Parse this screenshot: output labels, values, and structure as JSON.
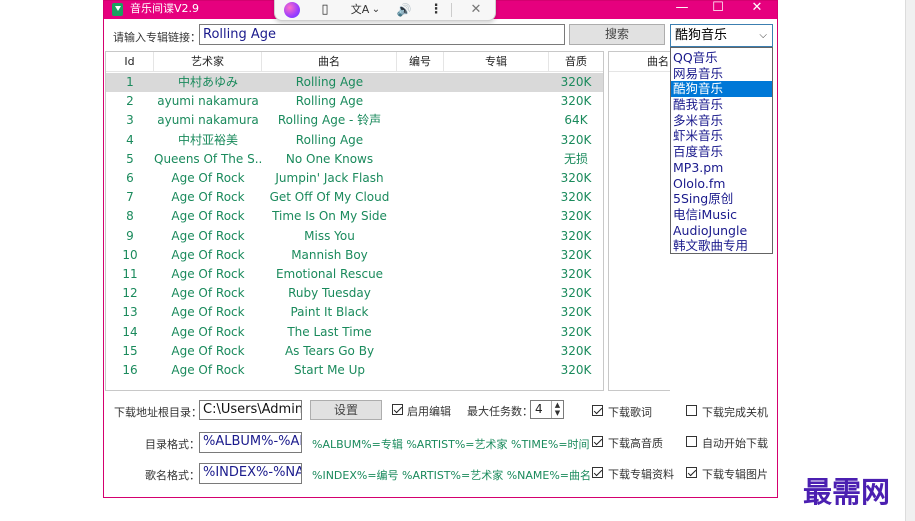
{
  "window": {
    "title": "音乐间谍V2.9",
    "controls": {
      "minimize": "—",
      "maximize": "☐",
      "close": "✕"
    }
  },
  "overlay_toolbar": {
    "icons": [
      "brain-icon",
      "tablet-icon",
      "translate-icon",
      "speaker-icon",
      "more-icon",
      "close-icon"
    ],
    "glyphs": {
      "tablet": "▯",
      "translate": "文A",
      "chevron": "⌄",
      "speaker": "🔊",
      "more": "⋮",
      "close": "✕"
    }
  },
  "search": {
    "label": "请输入专辑链接：",
    "value": "Rolling Age",
    "button": "搜索"
  },
  "source_select": {
    "selected": "酷狗音乐",
    "options": [
      "QQ音乐",
      "网易音乐",
      "酷狗音乐",
      "酷我音乐",
      "多米音乐",
      "虾米音乐",
      "百度音乐",
      "MP3.pm",
      "Ololo.fm",
      "5Sing原创",
      "电信iMusic",
      "AudioJungle",
      "韩文歌曲专用"
    ],
    "selected_index": 2
  },
  "table": {
    "headers": {
      "id": "Id",
      "artist": "艺术家",
      "name": "曲名",
      "number": "编号",
      "album": "专辑",
      "quality": "音质"
    },
    "rows": [
      {
        "id": "1",
        "artist": "中村あゆみ",
        "name": "Rolling Age",
        "number": "",
        "album": "",
        "quality": "320K"
      },
      {
        "id": "2",
        "artist": "ayumi nakamura",
        "name": "Rolling Age",
        "number": "",
        "album": "",
        "quality": "320K"
      },
      {
        "id": "3",
        "artist": "ayumi nakamura",
        "name": "Rolling Age - 铃声",
        "number": "",
        "album": "",
        "quality": "64K"
      },
      {
        "id": "4",
        "artist": "中村亚裕美",
        "name": "Rolling Age",
        "number": "",
        "album": "",
        "quality": "320K"
      },
      {
        "id": "5",
        "artist": "Queens Of The S...",
        "name": "No One Knows",
        "number": "",
        "album": "",
        "quality": "无损"
      },
      {
        "id": "6",
        "artist": "Age Of Rock",
        "name": "Jumpin' Jack Flash",
        "number": "",
        "album": "",
        "quality": "320K"
      },
      {
        "id": "7",
        "artist": "Age Of Rock",
        "name": "Get Off Of My Cloud",
        "number": "",
        "album": "",
        "quality": "320K"
      },
      {
        "id": "8",
        "artist": "Age Of Rock",
        "name": "Time Is On My Side",
        "number": "",
        "album": "",
        "quality": "320K"
      },
      {
        "id": "9",
        "artist": "Age Of Rock",
        "name": "Miss You",
        "number": "",
        "album": "",
        "quality": "320K"
      },
      {
        "id": "10",
        "artist": "Age Of Rock",
        "name": "Mannish Boy",
        "number": "",
        "album": "",
        "quality": "320K"
      },
      {
        "id": "11",
        "artist": "Age Of Rock",
        "name": "Emotional Rescue",
        "number": "",
        "album": "",
        "quality": "320K"
      },
      {
        "id": "12",
        "artist": "Age Of Rock",
        "name": "Ruby Tuesday",
        "number": "",
        "album": "",
        "quality": "320K"
      },
      {
        "id": "13",
        "artist": "Age Of Rock",
        "name": "Paint It Black",
        "number": "",
        "album": "",
        "quality": "320K"
      },
      {
        "id": "14",
        "artist": "Age Of Rock",
        "name": "The Last Time",
        "number": "",
        "album": "",
        "quality": "320K"
      },
      {
        "id": "15",
        "artist": "Age Of Rock",
        "name": "As Tears Go By",
        "number": "",
        "album": "",
        "quality": "320K"
      },
      {
        "id": "16",
        "artist": "Age Of Rock",
        "name": "Start Me Up",
        "number": "",
        "album": "",
        "quality": "320K"
      }
    ],
    "selected_row": 0
  },
  "side_table": {
    "header": "曲名"
  },
  "settings": {
    "download_dir_label": "下载地址根目录：",
    "download_dir_value": "C:\\Users\\Adminis",
    "settings_button": "设置",
    "enable_edit_label": "启用编辑",
    "max_tasks_label": "最大任务数：",
    "max_tasks_value": "4",
    "dir_format_label": "目录格式：",
    "dir_format_value": "%ALBUM%-%AR",
    "dir_format_hint": "%ALBUM%=专辑 %ARTIST%=艺术家 %TIME%=时间",
    "song_format_label": "歌名格式：",
    "song_format_value": "%INDEX%-%NAM",
    "song_format_hint": "%INDEX%=编号 %ARTIST%=艺术家 %NAME%=曲名",
    "checkboxes": {
      "enable_edit": true,
      "download_lyrics": {
        "label": "下载歌词",
        "checked": true
      },
      "download_hq": {
        "label": "下载高音质",
        "checked": true
      },
      "download_album_info": {
        "label": "下载专辑资料",
        "checked": true
      },
      "shutdown_when_done": {
        "label": "下载完成关机",
        "checked": false
      },
      "auto_start": {
        "label": "自动开始下载",
        "checked": false
      },
      "download_album_cover": {
        "label": "下载专辑图片",
        "checked": true
      }
    }
  },
  "watermark": "最需网",
  "colors": {
    "titlebar": "#e6007e",
    "accent": "#0078d7",
    "cell_text": "#1a8a5c",
    "watermark": "#4b1fb1"
  }
}
